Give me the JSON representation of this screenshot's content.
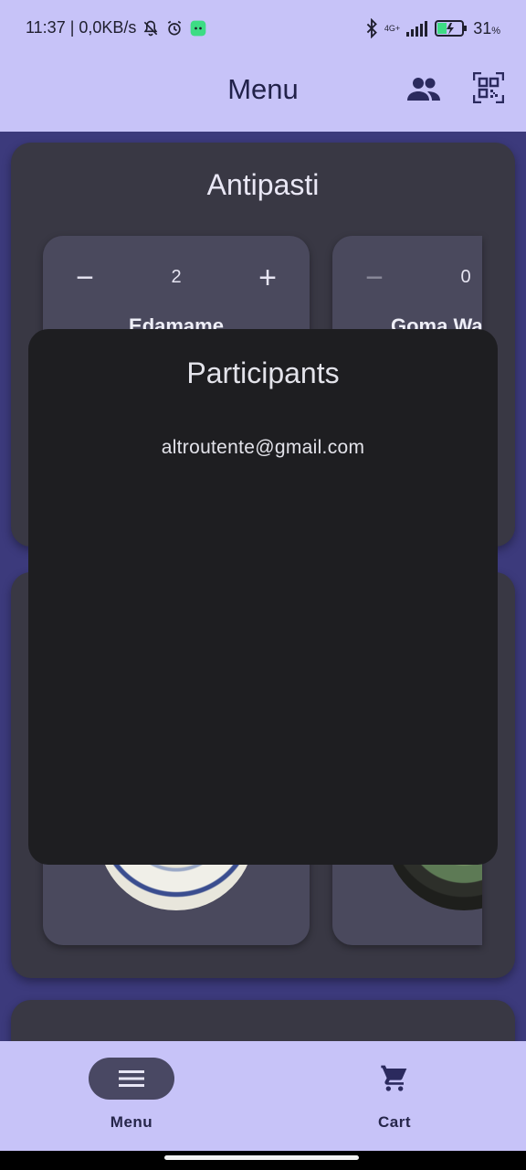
{
  "status": {
    "time_speed": "11:37 | 0,0KB/s",
    "network": "4G+",
    "battery": "31",
    "battery_unit": "%"
  },
  "appbar": {
    "title": "Menu",
    "participants_icon": "people-icon",
    "qr_icon": "qr-code-scanner-icon"
  },
  "sections": [
    {
      "title": "Antipasti",
      "items": [
        {
          "name": "Edamame",
          "qty": "2"
        },
        {
          "name": "Goma Wa",
          "qty": "0"
        }
      ]
    }
  ],
  "dialog": {
    "title": "Participants",
    "participants": [
      "altroutente@gmail.com"
    ]
  },
  "bottom_nav": {
    "items": [
      {
        "label": "Menu",
        "icon": "hamburger-menu-icon",
        "selected": true
      },
      {
        "label": "Cart",
        "icon": "cart-icon",
        "selected": false
      }
    ]
  },
  "colors": {
    "app_bar": "#c7c3f8",
    "background": "#3c3a7c",
    "section": "#393844",
    "card": "#4a495d",
    "dialog": "#1e1e21",
    "nav_pill": "#494863"
  }
}
